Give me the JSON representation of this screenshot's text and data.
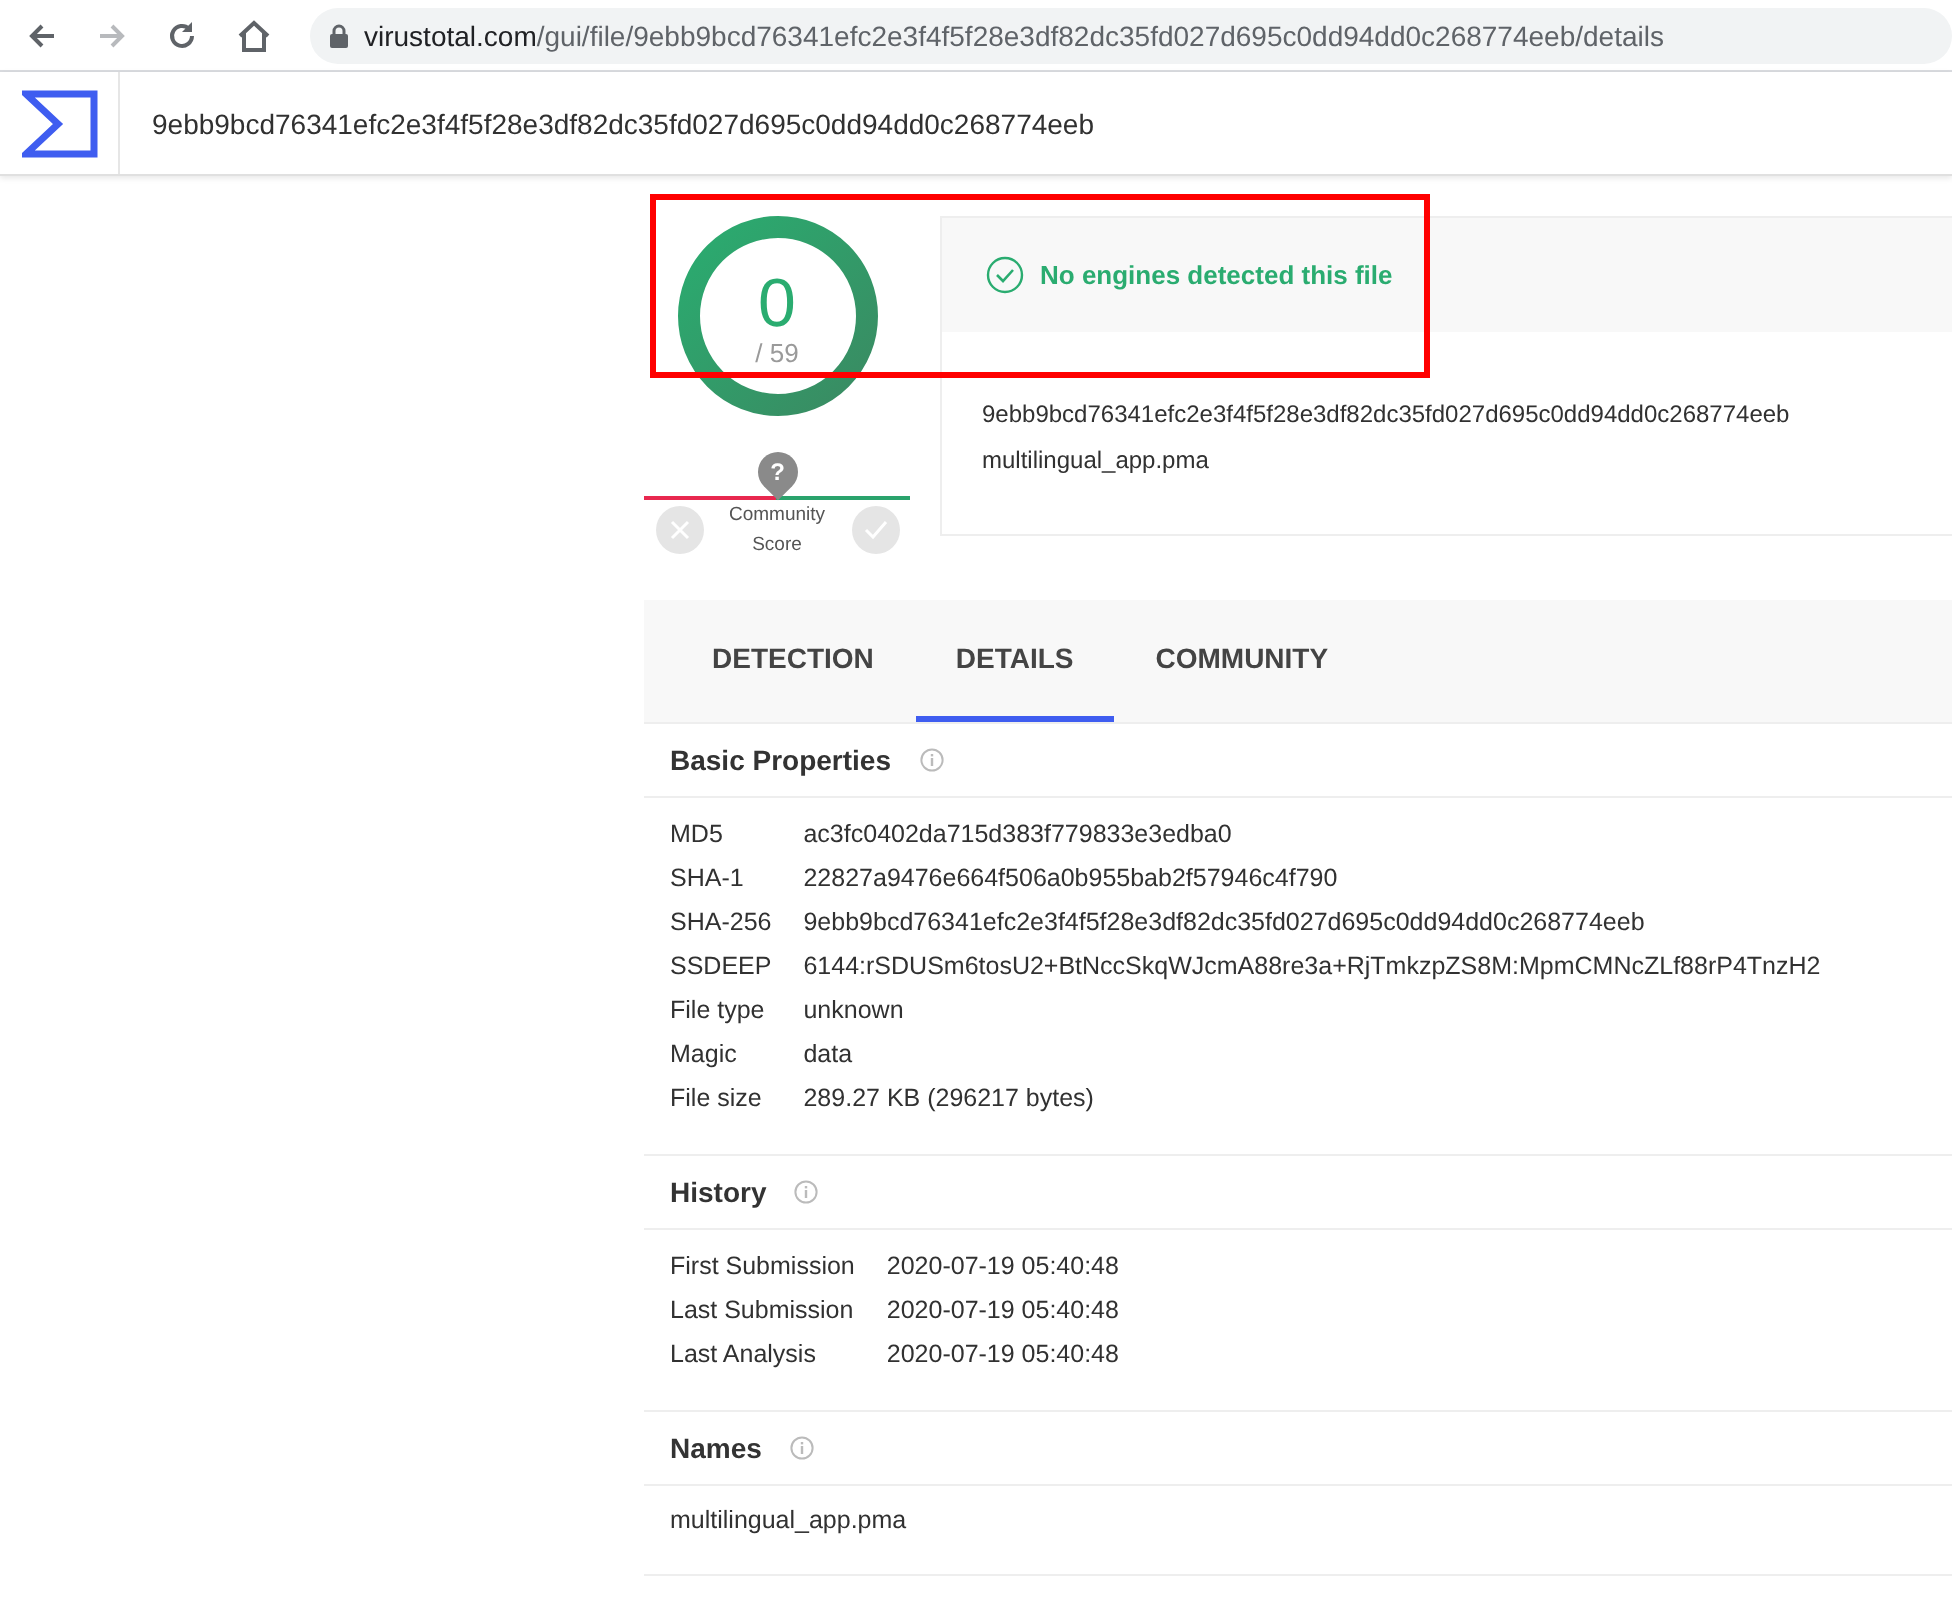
{
  "browser": {
    "url_host": "virustotal.com",
    "url_path": "/gui/file/9ebb9bcd76341efc2e3f4f5f28e3df82dc35fd027d695c0dd94dd0c268774eeb/details"
  },
  "header": {
    "search_value": "9ebb9bcd76341efc2e3f4f5f28e3df82dc35fd027d695c0dd94dd0c268774eeb"
  },
  "summary": {
    "detected": "0",
    "total": "/ 59",
    "community_label": "Community Score",
    "community_marker": "?",
    "verdict": "No engines detected this file",
    "hash": "9ebb9bcd76341efc2e3f4f5f28e3df82dc35fd027d695c0dd94dd0c268774eeb",
    "file_name": "multilingual_app.pma"
  },
  "tabs": [
    {
      "label": "DETECTION",
      "selected": false
    },
    {
      "label": "DETAILS",
      "selected": true
    },
    {
      "label": "COMMUNITY",
      "selected": false
    }
  ],
  "sections": [
    {
      "kind": "properties",
      "title": "Basic Properties",
      "rows": [
        {
          "label": "MD5",
          "value": "ac3fc0402da715d383f779833e3edba0"
        },
        {
          "label": "SHA-1",
          "value": "22827a9476e664f506a0b955bab2f57946c4f790"
        },
        {
          "label": "SHA-256",
          "value": "9ebb9bcd76341efc2e3f4f5f28e3df82dc35fd027d695c0dd94dd0c268774eeb"
        },
        {
          "label": "SSDEEP",
          "value": "6144:rSDUSm6tosU2+BtNccSkqWJcmA88re3a+RjTmkzpZS8M:MpmCMNcZLf88rP4TnzH2"
        },
        {
          "label": "File type",
          "value": "unknown"
        },
        {
          "label": "Magic",
          "value": "data"
        },
        {
          "label": "File size",
          "value": "289.27 KB (296217 bytes)"
        }
      ]
    },
    {
      "kind": "properties",
      "title": "History",
      "rows": [
        {
          "label": "First Submission",
          "value": "2020-07-19 05:40:48"
        },
        {
          "label": "Last Submission",
          "value": "2020-07-19 05:40:48"
        },
        {
          "label": "Last Analysis",
          "value": "2020-07-19 05:40:48"
        }
      ]
    },
    {
      "kind": "list",
      "title": "Names",
      "items": [
        "multilingual_app.pma"
      ]
    }
  ],
  "annotations": [
    {
      "kind": "rectangle"
    }
  ]
}
